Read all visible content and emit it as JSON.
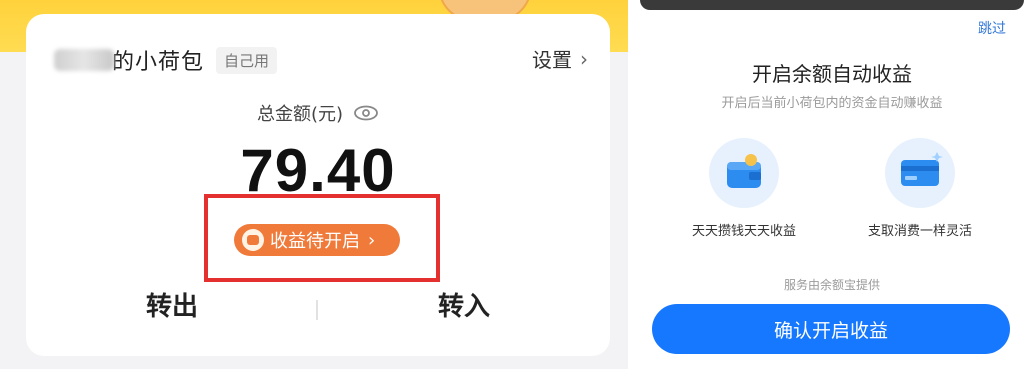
{
  "wallet": {
    "title": "的小荷包",
    "self_tag": "自己用",
    "settings_label": "设置",
    "balance_label": "总金额(元)",
    "balance_value": "79.40",
    "earn_status": "收益待开启",
    "transfer_out": "转出",
    "transfer_in": "转入"
  },
  "modal": {
    "skip_label": "跳过",
    "title": "开启余额自动收益",
    "subtitle": "开启后当前小荷包内的资金自动赚收益",
    "features": [
      {
        "label": "天天攒钱天天收益",
        "icon": "wallet-icon"
      },
      {
        "label": "支取消费一样灵活",
        "icon": "card-icon"
      }
    ],
    "service_note": "服务由余额宝提供",
    "confirm_label": "确认开启收益"
  },
  "colors": {
    "brand_yellow": "#ffd23c",
    "earn_orange": "#f07a3a",
    "highlight_red": "#e53030",
    "primary_blue": "#1677ff",
    "link_blue": "#3479d8"
  }
}
